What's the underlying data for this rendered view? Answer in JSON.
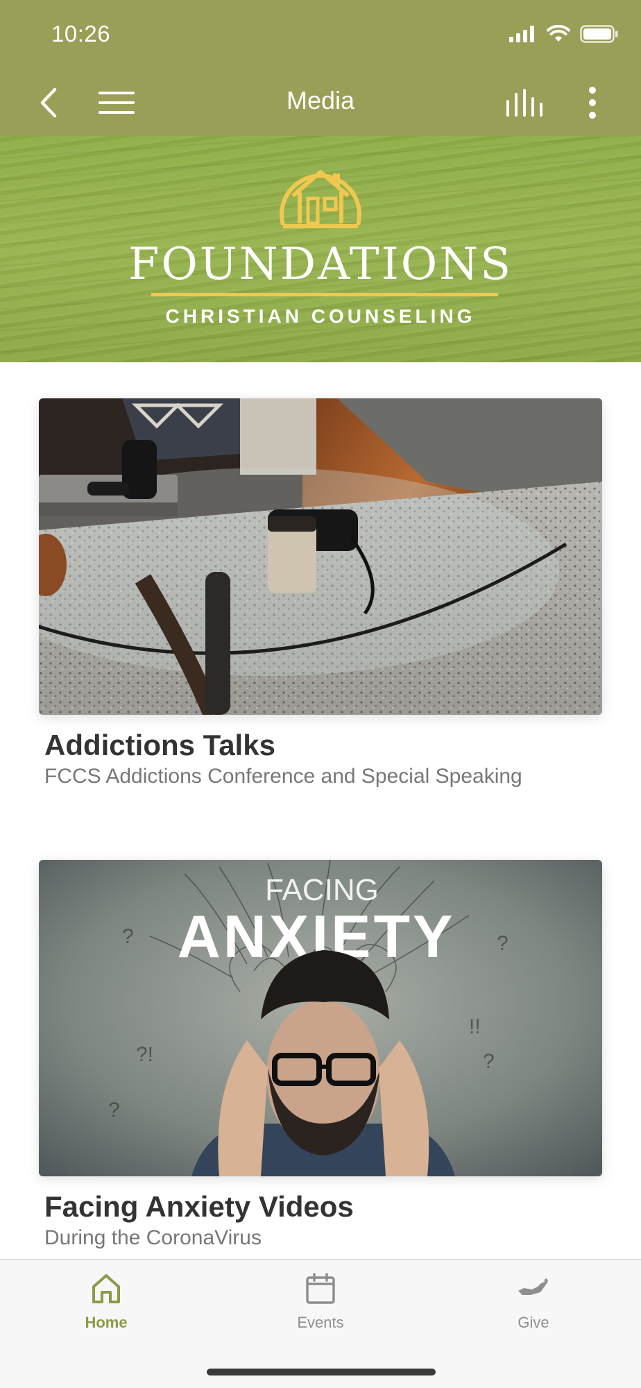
{
  "status_bar": {
    "time": "10:26"
  },
  "nav": {
    "title": "Media"
  },
  "banner": {
    "title": "FOUNDATIONS",
    "subtitle": "CHRISTIAN COUNSELING"
  },
  "cards": [
    {
      "title": "Addictions Talks",
      "subtitle": "FCCS Addictions Conference and Special Speaking"
    },
    {
      "title": "Facing Anxiety Videos",
      "subtitle": "During the CoronaVirus",
      "image_text_1": "FACING",
      "image_text_2": "ANXIETY"
    }
  ],
  "tabs": [
    {
      "label": "Home",
      "icon": "home-icon",
      "active": true
    },
    {
      "label": "Events",
      "icon": "calendar-icon",
      "active": false
    },
    {
      "label": "Give",
      "icon": "give-hand-icon",
      "active": false
    }
  ],
  "colors": {
    "header": "#9a9f57",
    "accent": "#8c9a45",
    "logo_gold": "#f0c850"
  }
}
